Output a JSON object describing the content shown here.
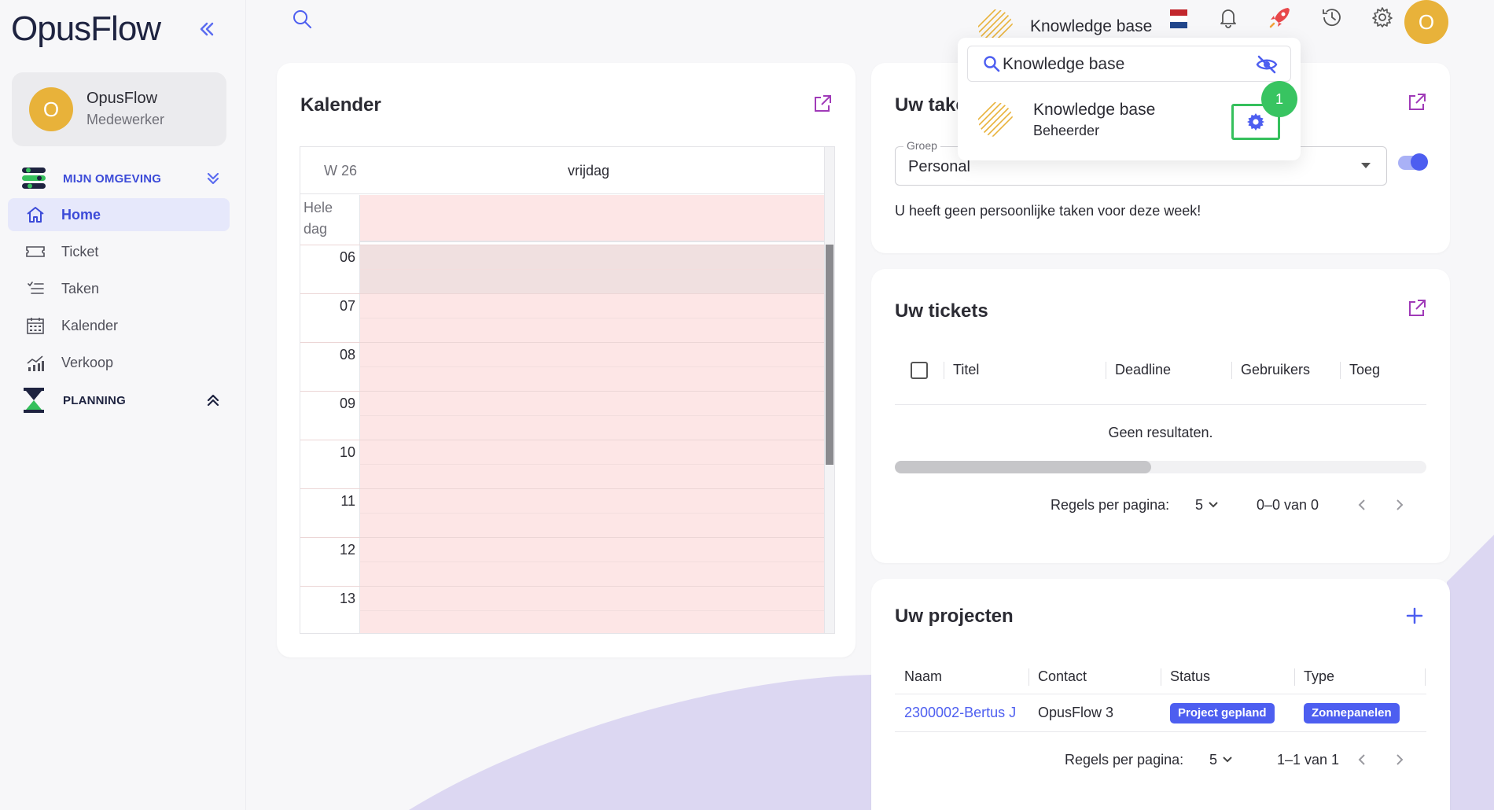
{
  "app": {
    "logo_text": "OpusFlow"
  },
  "profile": {
    "initial": "O",
    "name": "OpusFlow",
    "role": "Medewerker"
  },
  "sidebar": {
    "section_main": "MIJN OMGEVING",
    "items": [
      {
        "label": "Home",
        "icon": "home-icon",
        "active": true
      },
      {
        "label": "Ticket",
        "icon": "ticket-icon"
      },
      {
        "label": "Taken",
        "icon": "list-icon"
      },
      {
        "label": "Kalender",
        "icon": "calendar-icon"
      },
      {
        "label": "Verkoop",
        "icon": "chart-icon"
      }
    ],
    "section_planning": "PLANNING"
  },
  "topbar": {
    "user_initial": "O"
  },
  "knowledge_base": {
    "trigger_label": "Knowledge base",
    "search_value": "Knowledge base",
    "item_name": "Knowledge base",
    "item_role": "Beheerder",
    "step_number": "1"
  },
  "calendar": {
    "title": "Kalender",
    "week": "W 26",
    "day": "vrijdag",
    "all_day_label": "Hele dag",
    "hours": [
      "06",
      "07",
      "08",
      "09",
      "10",
      "11",
      "12",
      "13"
    ]
  },
  "tasks": {
    "title": "Uw taken",
    "group_label": "Groep",
    "group_value": "Personal",
    "empty_message": "U heeft geen persoonlijke taken voor deze week!"
  },
  "tickets": {
    "title": "Uw tickets",
    "columns": [
      "Titel",
      "Deadline",
      "Gebruikers",
      "Toeg"
    ],
    "empty_message": "Geen resultaten.",
    "rows_per_page_label": "Regels per pagina:",
    "rows_per_page": "5",
    "range": "0–0 van 0"
  },
  "projects": {
    "title": "Uw projecten",
    "columns": [
      "Naam",
      "Contact",
      "Status",
      "Type"
    ],
    "rows": [
      {
        "name": "2300002-Bertus J",
        "contact": "OpusFlow 3",
        "status": "Project gepland",
        "type": "Zonnepanelen"
      }
    ],
    "rows_per_page_label": "Regels per pagina:",
    "rows_per_page": "5",
    "range": "1–1 van 1"
  },
  "colors": {
    "accent": "#4d5ef0",
    "calendar_bg": "#fde6e6",
    "avatar": "#e8b23a",
    "highlight": "#35c05c"
  }
}
